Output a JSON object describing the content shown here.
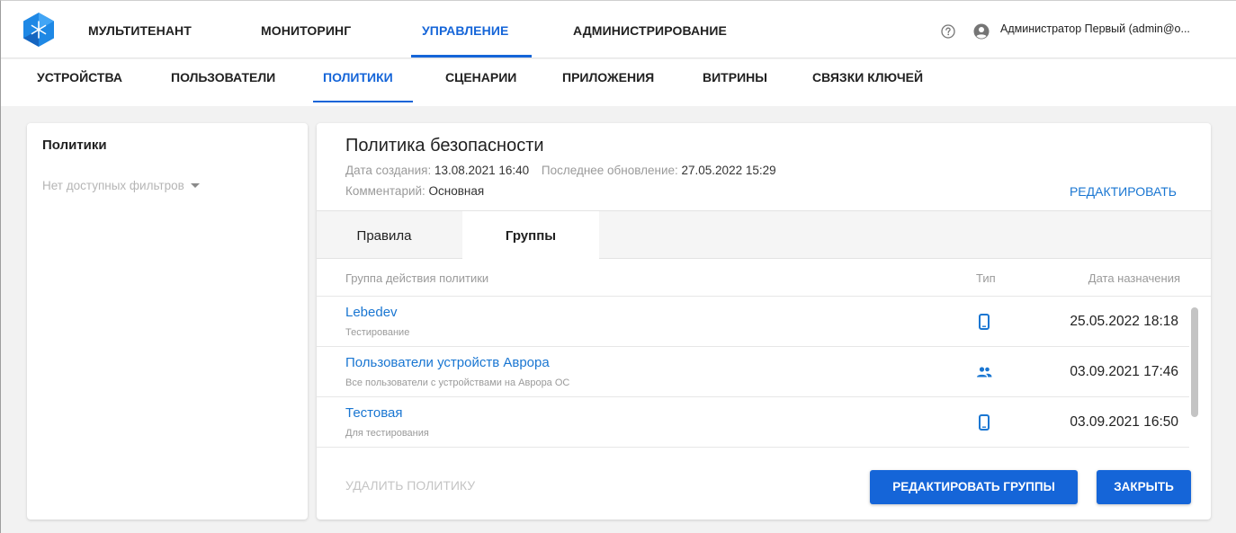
{
  "topnav": {
    "items": [
      "МУЛЬТИТЕНАНТ",
      "МОНИТОРИНГ",
      "УПРАВЛЕНИЕ",
      "АДМИНИСТРИРОВАНИЕ"
    ],
    "active": "УПРАВЛЕНИЕ",
    "user_name": "Администратор Первый (admin@o..."
  },
  "subnav": {
    "items": [
      "УСТРОЙСТВА",
      "ПОЛЬЗОВАТЕЛИ",
      "ПОЛИТИКИ",
      "СЦЕНАРИИ",
      "ПРИЛОЖЕНИЯ",
      "ВИТРИНЫ",
      "СВЯЗКИ КЛЮЧЕЙ"
    ],
    "active": "ПОЛИТИКИ"
  },
  "filter": {
    "title": "Политики",
    "select_value": "Нет доступных фильтров"
  },
  "policy": {
    "title": "Политика безопасности",
    "created_label": "Дата создания:",
    "created_value": "13.08.2021 16:40",
    "updated_label": "Последнее обновление:",
    "updated_value": "27.05.2022 15:29",
    "comment_label": "Комментарий:",
    "comment_value": "Основная",
    "edit_label": "РЕДАКТИРОВАТЬ"
  },
  "tabs": [
    "Правила",
    "Группы"
  ],
  "active_tab": "Группы",
  "table": {
    "columns": [
      "Группа действия политики",
      "Тип",
      "Дата назначения"
    ],
    "rows": [
      {
        "name": "Lebedev",
        "description": "Тестирование",
        "type_icon": "phone-icon",
        "date": "25.05.2022 18:18"
      },
      {
        "name": "Пользователи устройств Аврора",
        "description": "Все пользователи с устройствами на Аврора ОС",
        "type_icon": "users-group-icon",
        "date": "03.09.2021 17:46"
      },
      {
        "name": "Тестовая",
        "description": "Для тестирования",
        "type_icon": "phone-icon",
        "date": "03.09.2021 16:50"
      }
    ]
  },
  "actions": {
    "delete_label": "УДАЛИТЬ ПОЛИТИКУ",
    "edit_groups_label": "РЕДАКТИРОВАТЬ ГРУППЫ",
    "close_label": "ЗАКРЫТЬ"
  },
  "colors": {
    "accent": "#1565d8",
    "link": "#1976d2",
    "muted": "#9a9a9a",
    "background": "#f2f2f2"
  }
}
